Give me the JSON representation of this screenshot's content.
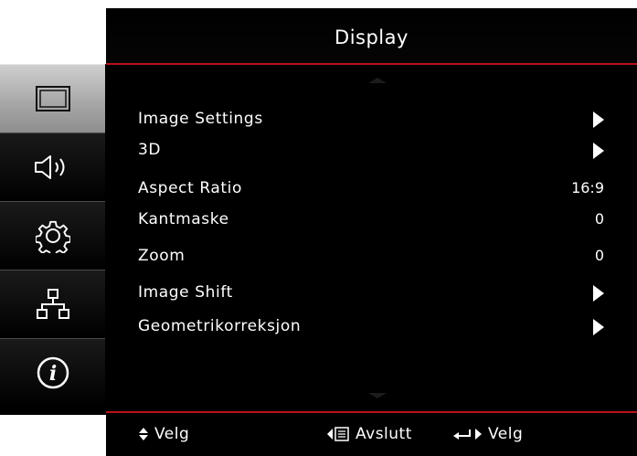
{
  "header": {
    "title": "Display"
  },
  "sidebar": {
    "items": [
      {
        "icon": "display-icon",
        "active": true
      },
      {
        "icon": "speaker-icon",
        "active": false
      },
      {
        "icon": "gear-icon",
        "active": false
      },
      {
        "icon": "network-icon",
        "active": false
      },
      {
        "icon": "info-icon",
        "active": false
      }
    ]
  },
  "menu": {
    "items": [
      {
        "label": "Image Settings",
        "value": "",
        "submenu": true
      },
      {
        "label": "3D",
        "value": "",
        "submenu": true
      },
      {
        "label": "Aspect Ratio",
        "value": "16:9",
        "submenu": false
      },
      {
        "label": "Kantmaske",
        "value": "0",
        "submenu": false
      },
      {
        "label": "Zoom",
        "value": "0",
        "submenu": false
      },
      {
        "label": "Image Shift",
        "value": "",
        "submenu": true
      },
      {
        "label": "Geometrikorreksjon",
        "value": "",
        "submenu": true
      }
    ]
  },
  "footer": {
    "select_label": "Velg",
    "exit_label": "Avslutt",
    "enter_label": "Velg"
  },
  "colors": {
    "accent": "#b8121a",
    "background": "#000000",
    "active_tab": "#b5b5b5"
  }
}
